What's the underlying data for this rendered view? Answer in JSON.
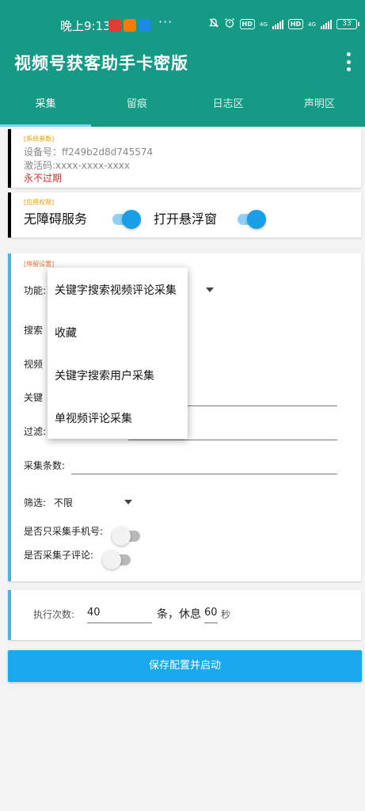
{
  "status_bar": {
    "time": "晚上9:13",
    "app_icons": [
      {
        "name": "amap-app-icon",
        "color": "#e53935"
      },
      {
        "name": "taobao-app-icon",
        "color": "#f57c00"
      },
      {
        "name": "zhihu-app-icon",
        "color": "#1e88e5"
      }
    ],
    "hd1": "HD",
    "net1": "4G",
    "hd2": "HD",
    "net2": "4G",
    "battery": "33"
  },
  "app": {
    "title": "视频号获客助手卡密版"
  },
  "tabs": [
    {
      "label": "采集",
      "active": true
    },
    {
      "label": "留痕",
      "active": false
    },
    {
      "label": "日志区",
      "active": false
    },
    {
      "label": "声明区",
      "active": false
    }
  ],
  "system": {
    "tag": "[系统参数]",
    "device": "设备号：ff249b2d8d745574",
    "activation": "激活码:xxxx-xxxx-xxxx",
    "expire": "永不过期"
  },
  "permissions": {
    "tag": "[应用权限]",
    "accessibility_label": "无障碍服务",
    "accessibility_on": true,
    "float_label": "打开悬浮窗",
    "float_on": true
  },
  "settings": {
    "tag": "[停留设置]",
    "function_label": "功能:",
    "search_label": "搜索",
    "video_label": "视频",
    "keyword_label": "关键",
    "filter_label": "过滤:",
    "count_label": "采集条数:",
    "count_value": "",
    "screen_label": "筛选:",
    "screen_value": "不限",
    "phone_only_label": "是否只采集手机号:",
    "phone_only_on": false,
    "sub_comment_label": "是否采集子评论:",
    "sub_comment_on": false
  },
  "execution": {
    "label": "执行次数:",
    "times": "40",
    "unit_rest": "条，休息",
    "rest": "60",
    "seconds": "秒"
  },
  "save_button": "保存配置并启动",
  "function_menu": {
    "options": [
      "关键字搜索视频评论采集",
      "收藏",
      "关键字搜索用户采集",
      "单视频评论采集"
    ]
  }
}
